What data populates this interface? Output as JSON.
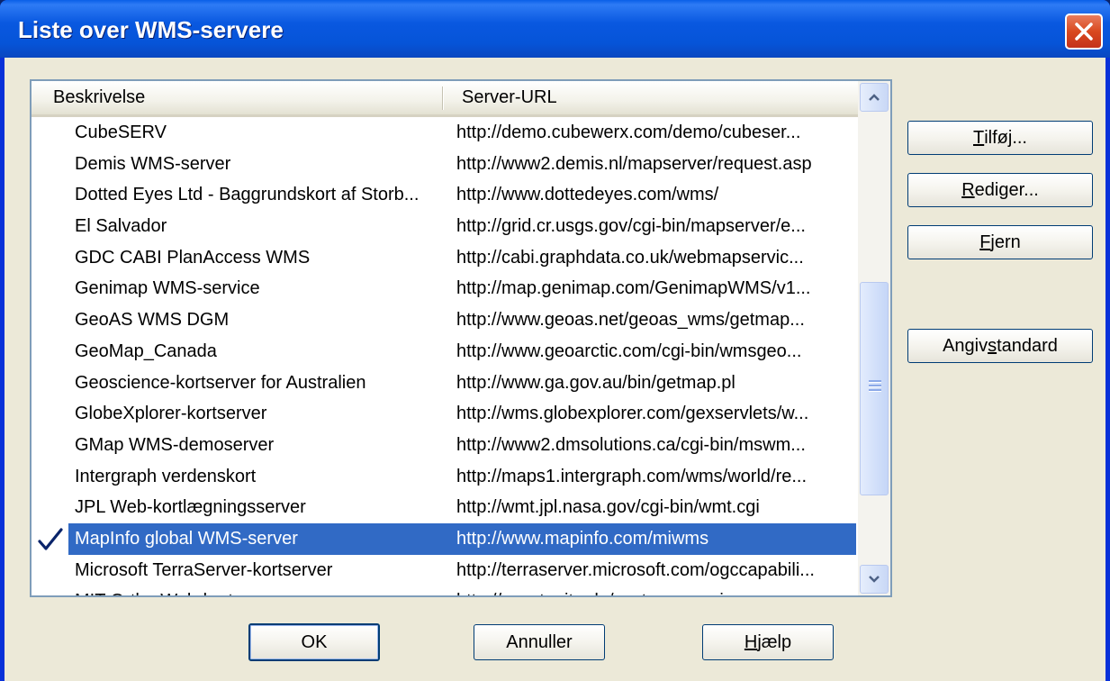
{
  "window": {
    "title": "Liste over WMS-servere",
    "close_label": "×"
  },
  "list": {
    "columns": [
      "Beskrivelse",
      "Server-URL"
    ],
    "rows": [
      {
        "desc": "CubeSERV",
        "url": "http://demo.cubewerx.com/demo/cubeser...",
        "selected": false
      },
      {
        "desc": "Demis WMS-server",
        "url": "http://www2.demis.nl/mapserver/request.asp",
        "selected": false
      },
      {
        "desc": "Dotted Eyes Ltd - Baggrundskort af Storb...",
        "url": "http://www.dottedeyes.com/wms/",
        "selected": false
      },
      {
        "desc": "El Salvador",
        "url": "http://grid.cr.usgs.gov/cgi-bin/mapserver/e...",
        "selected": false
      },
      {
        "desc": "GDC CABI PlanAccess WMS",
        "url": "http://cabi.graphdata.co.uk/webmapservic...",
        "selected": false
      },
      {
        "desc": "Genimap WMS-service",
        "url": "http://map.genimap.com/GenimapWMS/v1...",
        "selected": false
      },
      {
        "desc": "GeoAS WMS DGM",
        "url": "http://www.geoas.net/geoas_wms/getmap...",
        "selected": false
      },
      {
        "desc": "GeoMap_Canada",
        "url": "http://www.geoarctic.com/cgi-bin/wmsgeo...",
        "selected": false
      },
      {
        "desc": "Geoscience-kortserver for Australien",
        "url": "http://www.ga.gov.au/bin/getmap.pl",
        "selected": false
      },
      {
        "desc": "GlobeXplorer-kortserver",
        "url": "http://wms.globexplorer.com/gexservlets/w...",
        "selected": false
      },
      {
        "desc": "GMap WMS-demoserver",
        "url": "http://www2.dmsolutions.ca/cgi-bin/mswm...",
        "selected": false
      },
      {
        "desc": "Intergraph verdenskort",
        "url": "http://maps1.intergraph.com/wms/world/re...",
        "selected": false
      },
      {
        "desc": "JPL Web-kortlægningsserver",
        "url": "http://wmt.jpl.nasa.gov/cgi-bin/wmt.cgi",
        "selected": false
      },
      {
        "desc": "MapInfo global WMS-server",
        "url": "http://www.mapinfo.com/miwms",
        "selected": true
      },
      {
        "desc": "Microsoft TerraServer-kortserver",
        "url": "http://terraserver.microsoft.com/ogccapabili...",
        "selected": false
      },
      {
        "desc": "MIT Ortho Web-kortserver",
        "url": "http://coast.mit.edu/wmtserver.cgi",
        "selected": false
      }
    ]
  },
  "side_buttons": {
    "add": {
      "pre": "",
      "key": "T",
      "post": "ilføj..."
    },
    "edit": {
      "pre": "",
      "key": "R",
      "post": "ediger..."
    },
    "remove": {
      "pre": "",
      "key": "F",
      "post": "jern"
    },
    "set_default": {
      "pre": "Angiv ",
      "key": "s",
      "post": "tandard"
    }
  },
  "bottom_buttons": {
    "ok": "OK",
    "cancel": "Annuller",
    "help": {
      "pre": "",
      "key": "H",
      "post": "jælp"
    }
  },
  "colors": {
    "selection": "#316AC5",
    "titlebar": "#0A5FE8",
    "dialog_bg": "#ECE9D8"
  }
}
